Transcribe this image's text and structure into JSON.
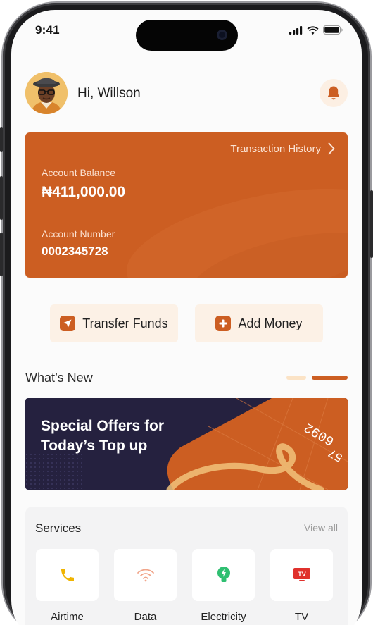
{
  "status_bar": {
    "time": "9:41",
    "icons": [
      "signal-icon",
      "wifi-icon",
      "battery-icon"
    ]
  },
  "header": {
    "greeting": "Hi, Willson",
    "avatar": "avatar",
    "notification_icon": "bell-icon"
  },
  "balance_card": {
    "transaction_history_label": "Transaction History",
    "balance_label": "Account Balance",
    "balance_value": "₦411,000.00",
    "account_number_label": "Account Number",
    "account_number_value": "0002345728"
  },
  "actions": {
    "transfer_label": "Transfer Funds",
    "add_money_label": "Add Money"
  },
  "whats_new": {
    "title": "What’s New",
    "carousel": {
      "total_pages": 2,
      "active_page": 2
    },
    "banner_title": "Special Offers for Today’s Top up"
  },
  "services": {
    "title": "Services",
    "view_all_label": "View all",
    "items": [
      {
        "label": "Airtime",
        "icon": "phone-icon"
      },
      {
        "label": "Data",
        "icon": "wifi-icon"
      },
      {
        "label": "Electricity",
        "icon": "lightbulb-icon"
      },
      {
        "label": "TV",
        "icon": "tv-icon"
      }
    ]
  },
  "colors": {
    "accent": "#cc5e22",
    "accent_light": "#fcf1e6",
    "banner_bg": "#25213f",
    "screen_bg": "#fbfbfb"
  }
}
